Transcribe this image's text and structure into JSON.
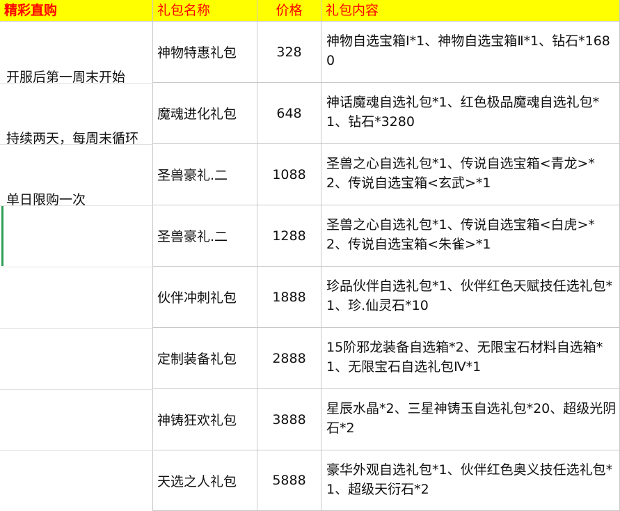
{
  "header": {
    "col1": "精彩直购",
    "col2": "礼包名称",
    "col3": "价格",
    "col4": "礼包内容"
  },
  "notes": {
    "line1": "开服后第一周末开始",
    "line2": "持续两天，每周末循环",
    "line3": "单日限购一次"
  },
  "rows": [
    {
      "name": "神物特惠礼包",
      "price": "328",
      "content": "神物自选宝箱Ⅰ*1、神物自选宝箱Ⅱ*1、钻石*1680"
    },
    {
      "name": "魔魂进化礼包",
      "price": "648",
      "content": "神话魔魂自选礼包*1、红色极品魔魂自选礼包*1、钻石*3280"
    },
    {
      "name": "圣兽豪礼.二",
      "price": "1088",
      "content": "圣兽之心自选礼包*1、传说自选宝箱<青龙>*2、传说自选宝箱<玄武>*1"
    },
    {
      "name": "圣兽豪礼.二",
      "price": "1288",
      "content": "圣兽之心自选礼包*1、传说自选宝箱<白虎>*2、传说自选宝箱<朱雀>*1"
    },
    {
      "name": "伙伴冲刺礼包",
      "price": "1888",
      "content": "珍品伙伴自选礼包*1、伙伴红色天赋技任选礼包*1、珍.仙灵石*10"
    },
    {
      "name": "定制装备礼包",
      "price": "2888",
      "content": "15阶邪龙装备自选箱*2、无限宝石材料自选箱*1、无限宝石自选礼包Ⅳ*1"
    },
    {
      "name": "神铸狂欢礼包",
      "price": "3888",
      "content": "星辰水晶*2、三星神铸玉自选礼包*20、超级光阴石*2"
    },
    {
      "name": "天选之人礼包",
      "price": "5888",
      "content": "豪华外观自选礼包*1、伙伴红色奥义技任选礼包*1、超级天衍石*2"
    }
  ]
}
